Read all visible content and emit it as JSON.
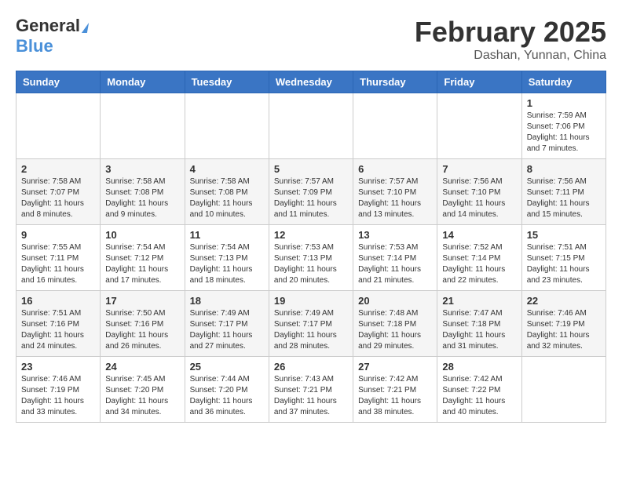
{
  "header": {
    "logo_general": "General",
    "logo_blue": "Blue",
    "month_title": "February 2025",
    "location": "Dashan, Yunnan, China"
  },
  "weekdays": [
    "Sunday",
    "Monday",
    "Tuesday",
    "Wednesday",
    "Thursday",
    "Friday",
    "Saturday"
  ],
  "weeks": [
    [
      {
        "day": "",
        "sunrise": "",
        "sunset": "",
        "daylight": ""
      },
      {
        "day": "",
        "sunrise": "",
        "sunset": "",
        "daylight": ""
      },
      {
        "day": "",
        "sunrise": "",
        "sunset": "",
        "daylight": ""
      },
      {
        "day": "",
        "sunrise": "",
        "sunset": "",
        "daylight": ""
      },
      {
        "day": "",
        "sunrise": "",
        "sunset": "",
        "daylight": ""
      },
      {
        "day": "",
        "sunrise": "",
        "sunset": "",
        "daylight": ""
      },
      {
        "day": "1",
        "sunrise": "Sunrise: 7:59 AM",
        "sunset": "Sunset: 7:06 PM",
        "daylight": "Daylight: 11 hours and 7 minutes."
      }
    ],
    [
      {
        "day": "2",
        "sunrise": "Sunrise: 7:58 AM",
        "sunset": "Sunset: 7:07 PM",
        "daylight": "Daylight: 11 hours and 8 minutes."
      },
      {
        "day": "3",
        "sunrise": "Sunrise: 7:58 AM",
        "sunset": "Sunset: 7:08 PM",
        "daylight": "Daylight: 11 hours and 9 minutes."
      },
      {
        "day": "4",
        "sunrise": "Sunrise: 7:58 AM",
        "sunset": "Sunset: 7:08 PM",
        "daylight": "Daylight: 11 hours and 10 minutes."
      },
      {
        "day": "5",
        "sunrise": "Sunrise: 7:57 AM",
        "sunset": "Sunset: 7:09 PM",
        "daylight": "Daylight: 11 hours and 11 minutes."
      },
      {
        "day": "6",
        "sunrise": "Sunrise: 7:57 AM",
        "sunset": "Sunset: 7:10 PM",
        "daylight": "Daylight: 11 hours and 13 minutes."
      },
      {
        "day": "7",
        "sunrise": "Sunrise: 7:56 AM",
        "sunset": "Sunset: 7:10 PM",
        "daylight": "Daylight: 11 hours and 14 minutes."
      },
      {
        "day": "8",
        "sunrise": "Sunrise: 7:56 AM",
        "sunset": "Sunset: 7:11 PM",
        "daylight": "Daylight: 11 hours and 15 minutes."
      }
    ],
    [
      {
        "day": "9",
        "sunrise": "Sunrise: 7:55 AM",
        "sunset": "Sunset: 7:11 PM",
        "daylight": "Daylight: 11 hours and 16 minutes."
      },
      {
        "day": "10",
        "sunrise": "Sunrise: 7:54 AM",
        "sunset": "Sunset: 7:12 PM",
        "daylight": "Daylight: 11 hours and 17 minutes."
      },
      {
        "day": "11",
        "sunrise": "Sunrise: 7:54 AM",
        "sunset": "Sunset: 7:13 PM",
        "daylight": "Daylight: 11 hours and 18 minutes."
      },
      {
        "day": "12",
        "sunrise": "Sunrise: 7:53 AM",
        "sunset": "Sunset: 7:13 PM",
        "daylight": "Daylight: 11 hours and 20 minutes."
      },
      {
        "day": "13",
        "sunrise": "Sunrise: 7:53 AM",
        "sunset": "Sunset: 7:14 PM",
        "daylight": "Daylight: 11 hours and 21 minutes."
      },
      {
        "day": "14",
        "sunrise": "Sunrise: 7:52 AM",
        "sunset": "Sunset: 7:14 PM",
        "daylight": "Daylight: 11 hours and 22 minutes."
      },
      {
        "day": "15",
        "sunrise": "Sunrise: 7:51 AM",
        "sunset": "Sunset: 7:15 PM",
        "daylight": "Daylight: 11 hours and 23 minutes."
      }
    ],
    [
      {
        "day": "16",
        "sunrise": "Sunrise: 7:51 AM",
        "sunset": "Sunset: 7:16 PM",
        "daylight": "Daylight: 11 hours and 24 minutes."
      },
      {
        "day": "17",
        "sunrise": "Sunrise: 7:50 AM",
        "sunset": "Sunset: 7:16 PM",
        "daylight": "Daylight: 11 hours and 26 minutes."
      },
      {
        "day": "18",
        "sunrise": "Sunrise: 7:49 AM",
        "sunset": "Sunset: 7:17 PM",
        "daylight": "Daylight: 11 hours and 27 minutes."
      },
      {
        "day": "19",
        "sunrise": "Sunrise: 7:49 AM",
        "sunset": "Sunset: 7:17 PM",
        "daylight": "Daylight: 11 hours and 28 minutes."
      },
      {
        "day": "20",
        "sunrise": "Sunrise: 7:48 AM",
        "sunset": "Sunset: 7:18 PM",
        "daylight": "Daylight: 11 hours and 29 minutes."
      },
      {
        "day": "21",
        "sunrise": "Sunrise: 7:47 AM",
        "sunset": "Sunset: 7:18 PM",
        "daylight": "Daylight: 11 hours and 31 minutes."
      },
      {
        "day": "22",
        "sunrise": "Sunrise: 7:46 AM",
        "sunset": "Sunset: 7:19 PM",
        "daylight": "Daylight: 11 hours and 32 minutes."
      }
    ],
    [
      {
        "day": "23",
        "sunrise": "Sunrise: 7:46 AM",
        "sunset": "Sunset: 7:19 PM",
        "daylight": "Daylight: 11 hours and 33 minutes."
      },
      {
        "day": "24",
        "sunrise": "Sunrise: 7:45 AM",
        "sunset": "Sunset: 7:20 PM",
        "daylight": "Daylight: 11 hours and 34 minutes."
      },
      {
        "day": "25",
        "sunrise": "Sunrise: 7:44 AM",
        "sunset": "Sunset: 7:20 PM",
        "daylight": "Daylight: 11 hours and 36 minutes."
      },
      {
        "day": "26",
        "sunrise": "Sunrise: 7:43 AM",
        "sunset": "Sunset: 7:21 PM",
        "daylight": "Daylight: 11 hours and 37 minutes."
      },
      {
        "day": "27",
        "sunrise": "Sunrise: 7:42 AM",
        "sunset": "Sunset: 7:21 PM",
        "daylight": "Daylight: 11 hours and 38 minutes."
      },
      {
        "day": "28",
        "sunrise": "Sunrise: 7:42 AM",
        "sunset": "Sunset: 7:22 PM",
        "daylight": "Daylight: 11 hours and 40 minutes."
      },
      {
        "day": "",
        "sunrise": "",
        "sunset": "",
        "daylight": ""
      }
    ]
  ]
}
